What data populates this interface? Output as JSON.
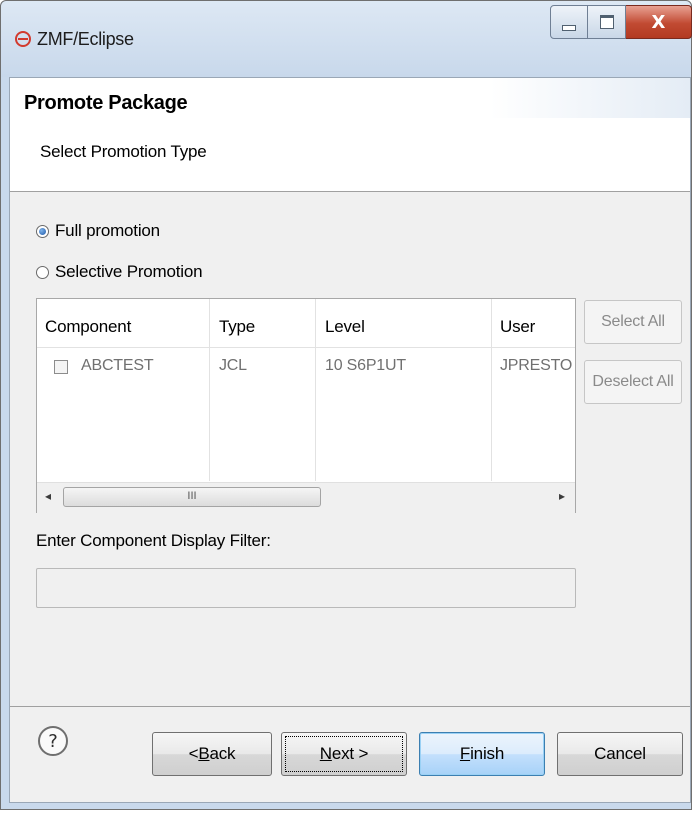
{
  "window": {
    "title": "ZMF/Eclipse",
    "close_glyph": "X"
  },
  "header": {
    "title": "Promote Package",
    "subtitle": "Select Promotion Type"
  },
  "promotion_type": {
    "options": [
      {
        "label": "Full promotion",
        "selected": true
      },
      {
        "label": "Selective Promotion",
        "selected": false
      }
    ]
  },
  "table": {
    "columns": [
      "Component",
      "Type",
      "Level",
      "User"
    ],
    "rows": [
      {
        "checked": false,
        "component": "ABCTEST",
        "type": "JCL",
        "level": "10 S6P1UT",
        "user": "JPRESTO"
      }
    ],
    "scroll_left": "◂",
    "scroll_right": "▸",
    "scroll_grip": "III"
  },
  "side_buttons": {
    "select_all": "Select All",
    "deselect_all": "Deselect All"
  },
  "filter": {
    "label": "Enter Component Display Filter:",
    "value": ""
  },
  "footer": {
    "help_glyph": "?",
    "back": {
      "prefix": "< ",
      "mnemonic": "B",
      "rest": "ack"
    },
    "next": {
      "mnemonic": "N",
      "rest": "ext >"
    },
    "finish": {
      "mnemonic": "F",
      "rest": "inish"
    },
    "cancel": "Cancel"
  },
  "colors": {
    "title_bar": "#c8d8eb",
    "close_button": "#c14a32",
    "default_button": "#a7d2f8",
    "disabled_text": "#8a8a8a"
  },
  "icons": [
    "eclipse-app-icon",
    "minimize-icon",
    "maximize-icon",
    "close-icon",
    "radio-selected-icon",
    "radio-unselected-icon",
    "help-icon",
    "scroll-left-icon",
    "scroll-right-icon"
  ]
}
